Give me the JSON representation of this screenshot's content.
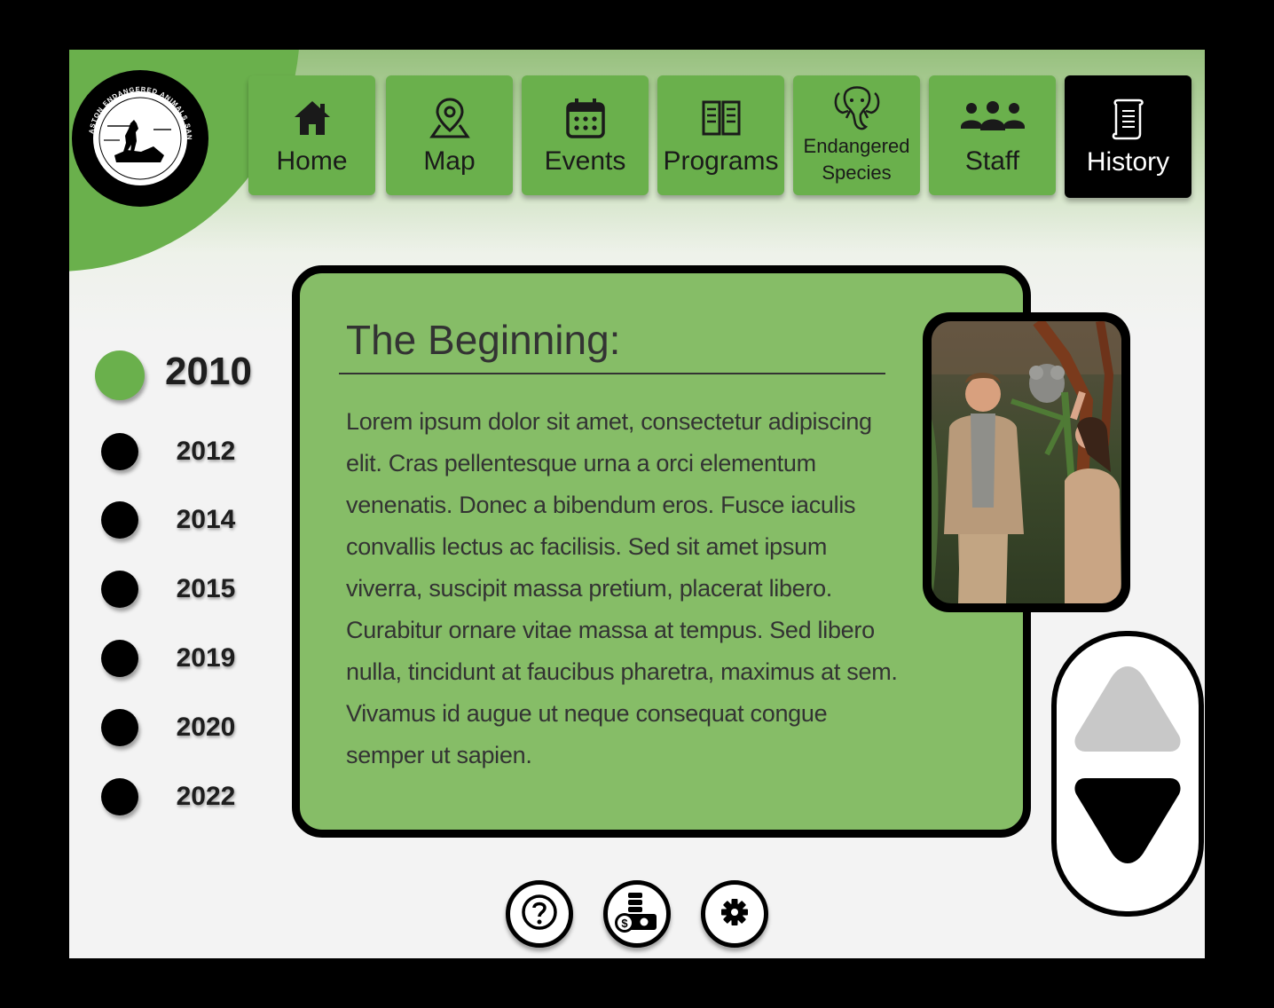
{
  "app": {
    "logo_text": "ASTON ENDANGERED ANIMALS SANCTUARY"
  },
  "nav": {
    "items": [
      {
        "label": "Home",
        "icon": "home-icon"
      },
      {
        "label": "Map",
        "icon": "map-pin-icon"
      },
      {
        "label": "Events",
        "icon": "calendar-icon"
      },
      {
        "label": "Programs",
        "icon": "book-icon"
      },
      {
        "label": "Endangered",
        "label2": "Species",
        "icon": "elephant-icon"
      },
      {
        "label": "Staff",
        "icon": "people-icon"
      },
      {
        "label": "History",
        "icon": "scroll-icon",
        "active": true
      }
    ]
  },
  "timeline": {
    "years": [
      "2010",
      "2012",
      "2014",
      "2015",
      "2019",
      "2020",
      "2022"
    ],
    "active": "2010"
  },
  "content": {
    "title": "The Beginning:",
    "body": "Lorem ipsum dolor sit amet, consectetur adipiscing elit. Cras pellentesque urna a orci elementum venenatis. Donec a bibendum eros. Fusce iaculis convallis lectus ac facilisis. Sed sit amet ipsum viverra, suscipit massa pretium, placerat libero. Curabitur ornare vitae massa at tempus. Sed libero nulla, tincidunt at faucibus pharetra, maximus at sem. Vivamus id augue ut neque consequat congue semper ut sapien."
  },
  "bottom": {
    "buttons": [
      "help-icon",
      "donate-icon",
      "settings-icon"
    ]
  },
  "colors": {
    "accent": "#6ab04c",
    "card": "#86bd67",
    "text": "#333333",
    "scroll_up_disabled": "#c8c8c8"
  }
}
